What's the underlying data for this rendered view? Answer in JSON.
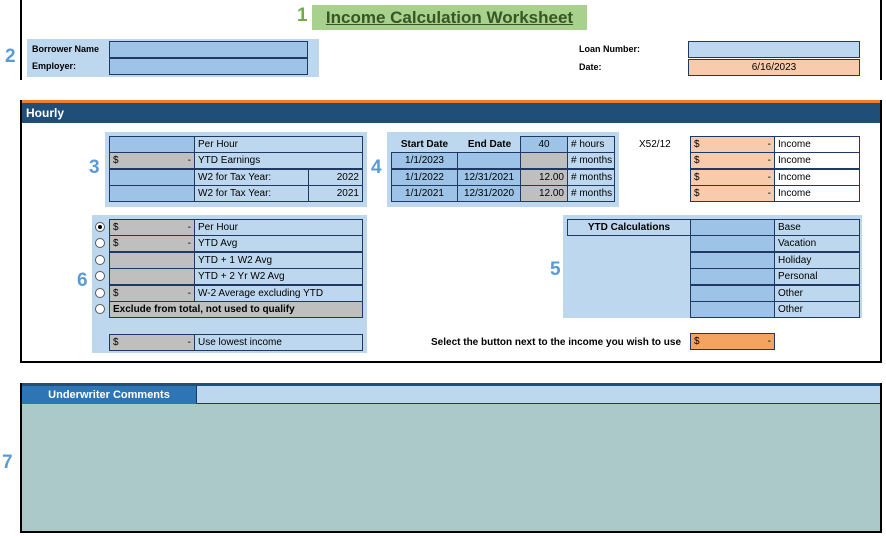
{
  "title": "Income Calculation Worksheet",
  "markers": {
    "m1": "1",
    "m2": "2",
    "m3": "3",
    "m4": "4",
    "m5": "5",
    "m6": "6",
    "m7": "7"
  },
  "header": {
    "borrower_label": "Borrower Name",
    "employer_label": "Employer:",
    "loan_number_label": "Loan Number:",
    "date_label": "Date:",
    "date_value": "6/16/2023"
  },
  "section_title": "Hourly",
  "block3": {
    "per_hour": "Per Hour",
    "ytd_earnings": "YTD Earnings",
    "w2_tax_year": "W2 for Tax Year:",
    "w2_year1": "2022",
    "w2_year2": "2021",
    "dollar": "$",
    "dash": "-"
  },
  "block4": {
    "start_date": "Start Date",
    "end_date": "End Date",
    "hours_value": "40",
    "hours_label": "# hours",
    "months_label": "# months",
    "x52": "X52/12",
    "rows": [
      {
        "start": "1/1/2023",
        "end": "",
        "months": ""
      },
      {
        "start": "1/1/2022",
        "end": "12/31/2021",
        "months": "12.00"
      },
      {
        "start": "1/1/2021",
        "end": "12/31/2020",
        "months": "12.00"
      }
    ],
    "income_label": "Income"
  },
  "block5": {
    "ytd_calc": "YTD Calculations",
    "items": [
      "Base",
      "Vacation",
      "Holiday",
      "Personal",
      "Other",
      "Other"
    ]
  },
  "block6": {
    "options": [
      "Per Hour",
      "YTD Avg",
      "YTD + 1 W2 Avg",
      "YTD + 2 Yr W2 Avg",
      "W-2 Average excluding YTD"
    ],
    "exclude": "Exclude from total, not used to qualify",
    "lowest": "Use lowest income"
  },
  "select_text": "Select the button next to the income you wish to use",
  "comments_title": "Underwriter Comments",
  "colors": {
    "navy": "#1f4e79",
    "accent_orange": "#f4a460",
    "comments_bg": "#acc9c9"
  }
}
